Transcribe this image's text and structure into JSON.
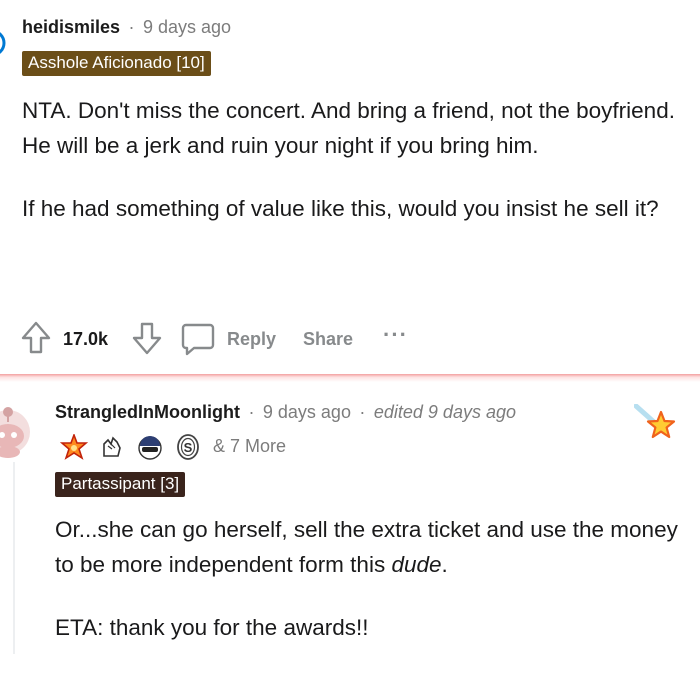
{
  "comment1": {
    "username": "heidismiles",
    "separator": "·",
    "time": "9 days ago",
    "flair": {
      "text": "Asshole Aficionado [10]",
      "bg": "#6b4e18"
    },
    "paragraphs": [
      "NTA. Don't miss the concert. And bring a friend, not the boyfriend. He will be a jerk and ruin your night if you bring him.",
      "If he had something of value like this, would you insist he sell it?"
    ],
    "actions": {
      "upvote_icon": "upvote-arrow-icon",
      "vote_count": "17.0k",
      "downvote_icon": "downvote-arrow-icon",
      "reply_icon": "comment-bubble-icon",
      "reply_label": "Reply",
      "share_label": "Share",
      "more_label": "···"
    }
  },
  "comment2": {
    "username": "StrangledInMoonlight",
    "separator1": "·",
    "time": "9 days ago",
    "separator2": "·",
    "edited": "edited 9 days ago",
    "awards": [
      "star-burst-award-icon",
      "hands-award-icon",
      "helmet-award-icon",
      "silver-coin-award-icon"
    ],
    "awards_more": "& 7 More",
    "flair": {
      "text": "Partassipant [3]",
      "bg": "#3a241c"
    },
    "paragraphs": {
      "p1_start": "Or...she can go herself, sell the extra ticket and use the money to be more independent form this ",
      "p1_em": "dude",
      "p1_end": ".",
      "p2": "ETA: thank you for the awards!!"
    },
    "corner_award_icon": "shooting-star-award-icon"
  },
  "colors": {
    "accent_flair1": "#6b4e18",
    "accent_flair2": "#3a241c",
    "muted": "#7c7c7c",
    "divider": "#f3a0a0"
  }
}
